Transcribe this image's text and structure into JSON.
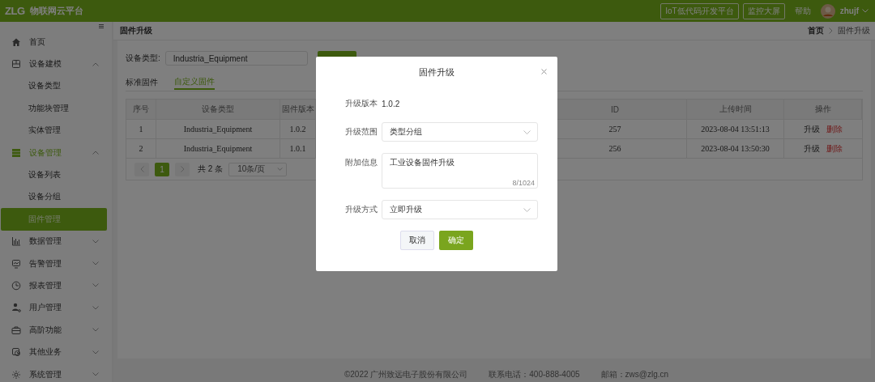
{
  "header": {
    "logo": "ZLG",
    "title": "物联网云平台",
    "links": [
      {
        "label": "IoT低代码开发平台",
        "kind": "outlined"
      },
      {
        "label": "监控大屏",
        "kind": "outlined"
      },
      {
        "label": "帮助",
        "kind": "plain"
      }
    ],
    "user": "zhujf"
  },
  "sidebar": {
    "items": [
      {
        "label": "首页"
      },
      {
        "label": "设备建模",
        "expanded": true,
        "children": [
          {
            "label": "设备类型",
            "selected": false
          },
          {
            "label": "功能块管理",
            "selected": false
          },
          {
            "label": "实体管理",
            "selected": false
          }
        ]
      },
      {
        "label": "设备管理",
        "expanded": true,
        "children": [
          {
            "label": "设备列表",
            "selected": false
          },
          {
            "label": "设备分组",
            "selected": false
          },
          {
            "label": "固件管理",
            "selected": true
          }
        ]
      },
      {
        "label": "数据管理",
        "expanded": false
      },
      {
        "label": "告警管理",
        "expanded": false
      },
      {
        "label": "报表管理",
        "expanded": false
      },
      {
        "label": "用户管理",
        "expanded": false
      },
      {
        "label": "高阶功能",
        "expanded": false
      },
      {
        "label": "其他业务",
        "expanded": false
      },
      {
        "label": "系统管理",
        "expanded": false
      }
    ]
  },
  "page": {
    "title": "固件升级",
    "breadcrumb": [
      {
        "label": "首页",
        "current": false
      },
      {
        "label": "固件升级",
        "current": true
      }
    ]
  },
  "filter": {
    "label": "设备类型:",
    "value": "Industria_Equipment"
  },
  "tabs": [
    {
      "label": "标准固件",
      "selected": false
    },
    {
      "label": "自定义固件",
      "selected": true
    }
  ],
  "table": {
    "columns": [
      "序号",
      "设备类型",
      "固件版本",
      "ID",
      "上传时间",
      "操作"
    ],
    "rows": [
      {
        "cells": [
          "1",
          "Industria_Equipment",
          "1.0.2",
          "257",
          "2023-08-04 13:51:13"
        ],
        "actions": [
          {
            "label": "升级",
            "kind": "normal"
          },
          {
            "label": "删除",
            "kind": "danger"
          }
        ]
      },
      {
        "cells": [
          "2",
          "Industria_Equipment",
          "1.0.1",
          "256",
          "2023-08-04 13:50:30"
        ],
        "actions": [
          {
            "label": "升级",
            "kind": "normal"
          },
          {
            "label": "删除",
            "kind": "danger"
          }
        ]
      }
    ]
  },
  "pagination": {
    "pages": [
      {
        "label": "1",
        "selected": true
      }
    ],
    "total": "共 2 条",
    "page_size": "10条/页"
  },
  "footer": [
    "©2022 广州致远电子股份有限公司",
    "联系电话：400-888-4005",
    "邮箱：zws@zlg.cn"
  ],
  "dialog": {
    "title": "固件升级",
    "fields": [
      {
        "kind": "text",
        "label": "升级版本",
        "value": "1.0.2"
      },
      {
        "kind": "select",
        "label": "升级范围",
        "value": "类型分组"
      },
      {
        "kind": "textarea",
        "label": "附加信息",
        "value": "工业设备固件升级",
        "counter": "8/1024"
      },
      {
        "kind": "select",
        "label": "升级方式",
        "value": "立即升级"
      }
    ],
    "buttons": [
      {
        "label": "取消",
        "kind": "default"
      },
      {
        "label": "确定",
        "kind": "primary"
      }
    ]
  }
}
